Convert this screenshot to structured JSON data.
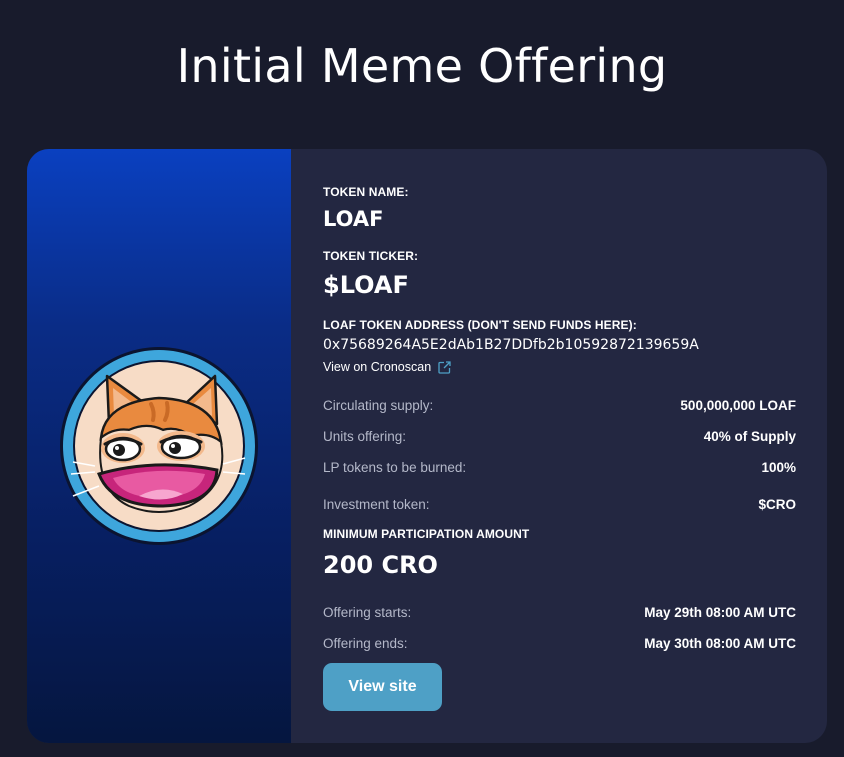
{
  "page": {
    "title": "Initial Meme Offering"
  },
  "token": {
    "name_label": "TOKEN NAME:",
    "name": "LOAF",
    "ticker_label": "TOKEN TICKER:",
    "ticker": "$LOAF",
    "address_label": "LOAF TOKEN ADDRESS (DON'T SEND FUNDS HERE):",
    "address": "0x75689264A5E2dAb1B27DDfb2b10592872139659A",
    "explorer_link": "View on Cronoscan",
    "explorer_icon": "external-link-icon",
    "logo_icon": "loaf-cat-logo"
  },
  "details": [
    {
      "key": "Circulating supply:",
      "value": "500,000,000 LOAF"
    },
    {
      "key": "Units offering:",
      "value": "40% of Supply"
    },
    {
      "key": "LP tokens to be burned:",
      "value": "100%"
    },
    {
      "key": "Investment token:",
      "value": "$CRO"
    }
  ],
  "minimum": {
    "label": "MINIMUM PARTICIPATION AMOUNT",
    "value": "200 CRO"
  },
  "schedule": [
    {
      "key": "Offering starts:",
      "value": "May 29th 08:00 AM UTC"
    },
    {
      "key": "Offering ends:",
      "value": "May 30th 08:00 AM UTC"
    }
  ],
  "actions": {
    "view_site": "View site"
  },
  "colors": {
    "background": "#181b2c",
    "card": "#232741",
    "accent_button": "#4ea0c6",
    "link_icon": "#4ea0c6",
    "muted_text": "#b4b8c9"
  }
}
